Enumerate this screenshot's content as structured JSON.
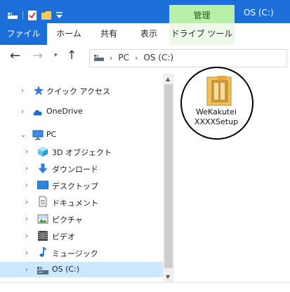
{
  "titlebar": {
    "context_tab": "管理",
    "title": "OS (C:)"
  },
  "ribbon": {
    "tabs": [
      "ファイル",
      "ホーム",
      "共有",
      "表示",
      "ドライブ ツール"
    ]
  },
  "address": {
    "breadcrumbs": [
      "PC",
      "OS (C:)"
    ]
  },
  "nav": {
    "items": [
      {
        "label": "クイック アクセス",
        "icon": "star-icon"
      },
      {
        "label": "OneDrive",
        "icon": "cloud-icon"
      },
      {
        "label": "PC",
        "icon": "monitor-icon"
      },
      {
        "label": "3D オブジェクト",
        "icon": "cube-icon"
      },
      {
        "label": "ダウンロード",
        "icon": "download-arrow-icon"
      },
      {
        "label": "デスクトップ",
        "icon": "desktop-icon"
      },
      {
        "label": "ドキュメント",
        "icon": "document-icon"
      },
      {
        "label": "ピクチャ",
        "icon": "picture-icon"
      },
      {
        "label": "ビデオ",
        "icon": "film-icon"
      },
      {
        "label": "ミュージック",
        "icon": "music-note-icon"
      },
      {
        "label": "OS (C:)",
        "icon": "drive-icon"
      }
    ]
  },
  "content": {
    "files": [
      {
        "name_line1": "WeKakutei",
        "name_line2": "XXXXSetup",
        "icon": "installer-icon"
      }
    ]
  },
  "colors": {
    "titlebar": "#1c6fd9",
    "manage_tab": "#b9f0a7",
    "selected": "#cce8ff"
  }
}
